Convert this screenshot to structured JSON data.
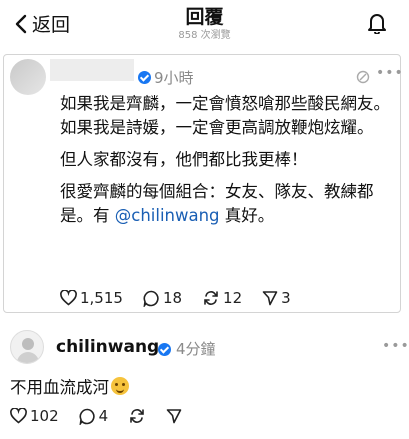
{
  "header": {
    "back_label": "返回",
    "title": "回覆",
    "view_count": "858 次瀏覽"
  },
  "post": {
    "time": "9小時",
    "lines": [
      "如果我是齊麟，一定會憤怒嗆那些酸民網友。",
      "如果我是詩媛，一定會更高調放鞭炮炫耀。",
      "但人家都沒有，他們都比我更棒！"
    ],
    "last_line_before": "很愛齊麟的每個組合：女友、隊友、教練都是。有 ",
    "mention": "@chilinwang",
    "last_line_after": " 真好。",
    "likes": "1,515",
    "comments": "18",
    "reposts": "12",
    "shares": "3"
  },
  "reply": {
    "username": "chilinwang",
    "time": "4分鐘",
    "text": "不用血流成河",
    "likes": "102",
    "comments": "4"
  },
  "colors": {
    "verified": "#1877f2",
    "mention": "#1a5fb4"
  }
}
